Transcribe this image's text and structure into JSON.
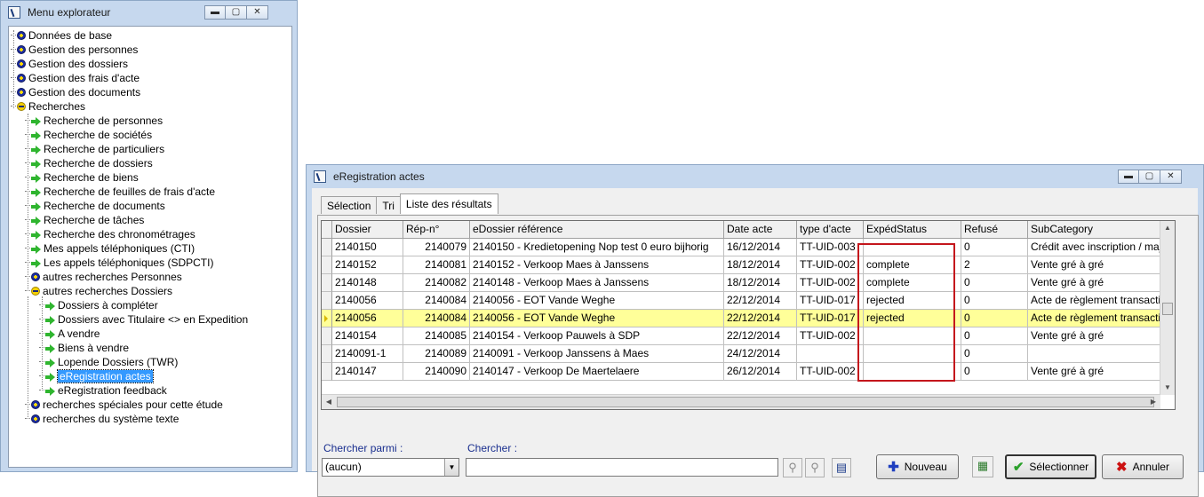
{
  "explorer": {
    "title": "Menu explorateur",
    "window_controls": [
      "▬",
      "▢",
      "✕"
    ],
    "tree": [
      {
        "label": "Données de base",
        "icon": "plus-icon",
        "level": 0
      },
      {
        "label": "Gestion des personnes",
        "icon": "plus-icon",
        "level": 0
      },
      {
        "label": "Gestion des dossiers",
        "icon": "plus-icon",
        "level": 0
      },
      {
        "label": "Gestion des frais d'acte",
        "icon": "plus-icon",
        "level": 0
      },
      {
        "label": "Gestion des documents",
        "icon": "plus-icon",
        "level": 0
      },
      {
        "label": "Recherches",
        "icon": "minus-icon",
        "level": 0
      },
      {
        "label": "Recherche de personnes",
        "icon": "arrow-icon",
        "level": 1
      },
      {
        "label": "Recherche de sociétés",
        "icon": "arrow-icon",
        "level": 1
      },
      {
        "label": "Recherche de particuliers",
        "icon": "arrow-icon",
        "level": 1
      },
      {
        "label": "Recherche de dossiers",
        "icon": "arrow-icon",
        "level": 1
      },
      {
        "label": "Recherche de biens",
        "icon": "arrow-icon",
        "level": 1
      },
      {
        "label": "Recherche de feuilles de frais d'acte",
        "icon": "arrow-icon",
        "level": 1
      },
      {
        "label": "Recherche de documents",
        "icon": "arrow-icon",
        "level": 1
      },
      {
        "label": "Recherche de tâches",
        "icon": "arrow-icon",
        "level": 1
      },
      {
        "label": "Recherche des chronométrages",
        "icon": "arrow-icon",
        "level": 1
      },
      {
        "label": "Mes appels téléphoniques (CTI)",
        "icon": "arrow-icon",
        "level": 1
      },
      {
        "label": "Les appels téléphoniques (SDPCTI)",
        "icon": "arrow-icon",
        "level": 1
      },
      {
        "label": "autres recherches Personnes",
        "icon": "plus-icon",
        "level": 1
      },
      {
        "label": "autres recherches Dossiers",
        "icon": "minus-icon",
        "level": 1
      },
      {
        "label": "Dossiers à compléter",
        "icon": "arrow-icon",
        "level": 2
      },
      {
        "label": "Dossiers avec Titulaire <> en Expedition",
        "icon": "arrow-icon",
        "level": 2
      },
      {
        "label": "A vendre",
        "icon": "arrow-icon",
        "level": 2
      },
      {
        "label": "Biens à vendre",
        "icon": "arrow-icon",
        "level": 2
      },
      {
        "label": "Lopende Dossiers (TWR)",
        "icon": "arrow-icon",
        "level": 2
      },
      {
        "label": "eRegistration actes",
        "icon": "arrow-icon",
        "level": 2,
        "selected": true
      },
      {
        "label": "eRegistration feedback",
        "icon": "arrow-icon",
        "level": 2
      },
      {
        "label": "recherches spéciales pour cette étude",
        "icon": "plus-icon",
        "level": 1
      },
      {
        "label": "recherches du système texte",
        "icon": "plus-icon",
        "level": 1
      }
    ]
  },
  "ereg": {
    "title": "eRegistration actes",
    "window_controls": [
      "▬",
      "▢",
      "✕"
    ],
    "tabs": [
      "Sélection",
      "Tri",
      "Liste des résultats"
    ],
    "active_tab": 2,
    "columns": [
      "Dossier",
      "Rép-n°",
      "eDossier référence",
      "Date acte",
      "type d'acte",
      "ExpédStatus",
      "Refusé",
      "SubCategory"
    ],
    "rows": [
      [
        "2140150",
        "2140079",
        "2140150 - Kredietopening Nop test 0 euro bijhorig",
        "16/12/2014",
        "TT-UID-003",
        "",
        "0",
        "Crédit avec inscription / maj"
      ],
      [
        "2140152",
        "2140081",
        "2140152 - Verkoop Maes à Janssens",
        "18/12/2014",
        "TT-UID-002",
        "complete",
        "2",
        "Vente gré à gré"
      ],
      [
        "2140148",
        "2140082",
        "2140148 - Verkoop Maes à Janssens",
        "18/12/2014",
        "TT-UID-002",
        "complete",
        "0",
        "Vente gré à gré"
      ],
      [
        "2140056",
        "2140084",
        "2140056 - EOT Vande Weghe",
        "22/12/2014",
        "TT-UID-017",
        "rejected",
        "0",
        "Acte de règlement transacti"
      ],
      [
        "2140056",
        "2140084",
        "2140056 - EOT Vande Weghe",
        "22/12/2014",
        "TT-UID-017",
        "rejected",
        "0",
        "Acte de règlement transacti"
      ],
      [
        "2140154",
        "2140085",
        "2140154 - Verkoop Pauwels à SDP",
        "22/12/2014",
        "TT-UID-002",
        "",
        "0",
        "Vente gré à gré"
      ],
      [
        "2140091-1",
        "2140089",
        "2140091 - Verkoop Janssens à Maes",
        "24/12/2014",
        "",
        "",
        "0",
        ""
      ],
      [
        "2140147",
        "2140090",
        "2140147 - Verkoop De Maertelaere",
        "26/12/2014",
        "TT-UID-002",
        "",
        "0",
        "Vente gré à gré"
      ]
    ],
    "highlighted_row": 4,
    "highlight_color": "#ffff99",
    "annotation_color": "#c4161c",
    "search": {
      "search_in_label": "Chercher parmi :",
      "search_in_value": "(aucun)",
      "search_label": "Chercher :",
      "search_value": ""
    },
    "buttons": {
      "new": "Nouveau",
      "select": "Sélectionner",
      "cancel": "Annuler"
    }
  }
}
